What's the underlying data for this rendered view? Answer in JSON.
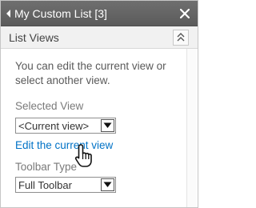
{
  "panel": {
    "title": "My Custom List [3]",
    "section_title": "List Views",
    "description": "You can edit the current view or select another view.",
    "selected_view_label": "Selected View",
    "selected_view_value": "<Current view>",
    "edit_link": "Edit the current view",
    "toolbar_type_label": "Toolbar Type",
    "toolbar_type_value": "Full Toolbar"
  },
  "icons": {
    "title_arrow": "caret-left-icon",
    "close": "close-icon",
    "collapse": "collapse-up-icon",
    "dropdown": "chevron-down-icon",
    "pointer": "hand-pointer-icon"
  },
  "colors": {
    "title_bar": "#5f5f5f",
    "link": "#0072c6",
    "section_bg": "#f1f1f1"
  }
}
